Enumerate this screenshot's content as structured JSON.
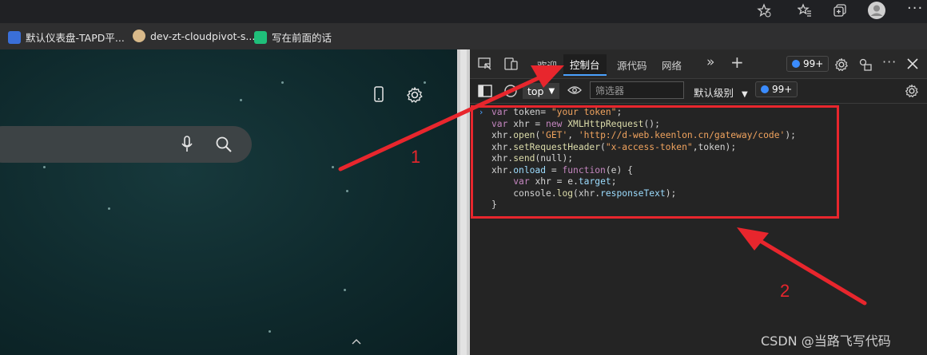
{
  "bookmarks": [
    {
      "label": "默认仪表盘-TAPD平...",
      "color": "#3a6fd8"
    },
    {
      "label": "dev-zt-cloudpivot-s...",
      "color": "#d8b98a"
    },
    {
      "label": "写在前面的话",
      "color": "#1fbf7a"
    }
  ],
  "devtools": {
    "tabs": [
      {
        "label": "欢迎"
      },
      {
        "label": "控制台",
        "active": true
      },
      {
        "label": "源代码"
      },
      {
        "label": "网络"
      }
    ],
    "issues_badge": "99+",
    "toolbar": {
      "context": "top",
      "filter_placeholder": "筛选器",
      "level": "默认级别",
      "issues_badge": "99+"
    },
    "console_code": [
      "var token= \"your token\";",
      "var xhr = new XMLHttpRequest();",
      "xhr.open('GET', 'http://d-web.keenlon.cn/gateway/code');",
      "xhr.setRequestHeader(\"x-access-token\",token);",
      "xhr.send(null);",
      "xhr.onload = function(e) {",
      "    var xhr = e.target;",
      "    console.log(xhr.responseText);",
      "}"
    ]
  },
  "annotations": {
    "label_1": "1",
    "label_2": "2"
  },
  "watermark": "CSDN @当路飞写代码",
  "colors": {
    "annotation": "#e8262d",
    "accent": "#4aa2ff"
  }
}
